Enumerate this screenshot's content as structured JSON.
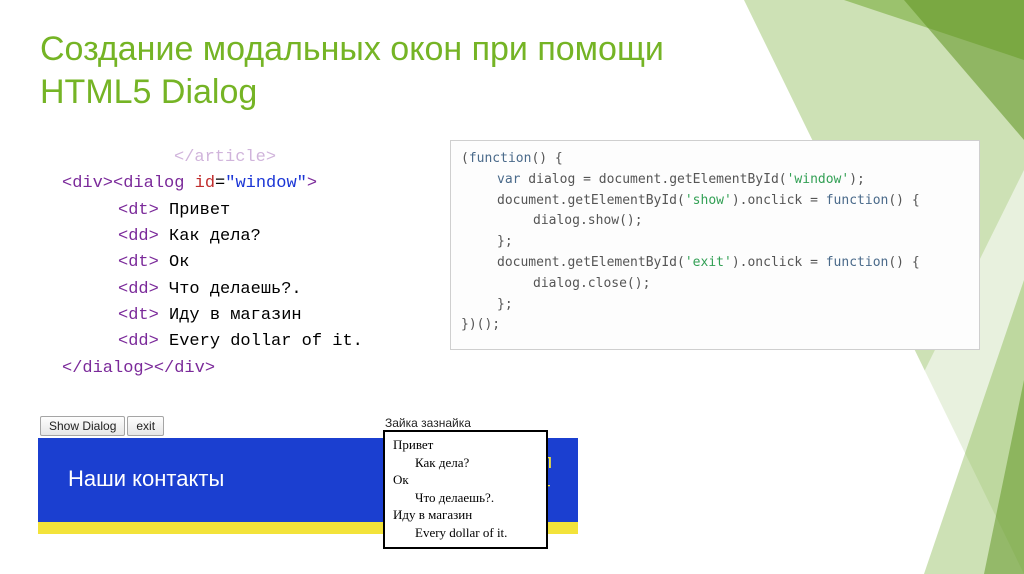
{
  "title_line1": "Создание модальных окон при помощи",
  "title_line2": "HTML5 Dialog",
  "html_code": {
    "l0": "</article>",
    "l1_open_div": "<div>",
    "l1_open_dialog": "<dialog",
    "l1_attr_id": " id",
    "l1_eq": "=",
    "l1_val": "\"window\"",
    "l1_close": ">",
    "l2_tag": "<dt>",
    "l2_txt": " Привет",
    "l3_tag": "<dd>",
    "l3_txt": " Как дела?",
    "l4_tag": "<dt>",
    "l4_txt": " Ок",
    "l5_tag": "<dd>",
    "l5_txt": " Что делаешь?.",
    "l6_tag": "<dt>",
    "l6_txt": " Иду в магазин",
    "l7_tag": "<dd>",
    "l7_txt": " Every dollar of it.",
    "l8_close_dialog": "</dialog>",
    "l8_close_div": "</div>"
  },
  "js_code": {
    "a": "(",
    "a_fn": "function",
    "a2": "() {",
    "b_var": "var",
    "b_rest": " dialog = document.getElementById(",
    "b_str": "'window'",
    "b_end": ");",
    "c_pre": "document.getElementById(",
    "c_str": "'show'",
    "c_mid": ").onclick = ",
    "c_fn": "function",
    "c_end": "() {",
    "d": "dialog.show();",
    "e": "};",
    "f_pre": "document.getElementById(",
    "f_str": "'exit'",
    "f_mid": ").onclick = ",
    "f_fn": "function",
    "f_end": "() {",
    "g": "dialog.close();",
    "h": "};",
    "i": "})();"
  },
  "buttons": {
    "show": "Show Dialog",
    "exit": "exit"
  },
  "caption": "Зайка зазнайка",
  "banner_text": "Наши контакты",
  "banner_extra_1": "ел",
  "banner_extra_2": "ит",
  "dialog_preview": {
    "dt1": "Привет",
    "dd1": "Как дела?",
    "dt2": "Ок",
    "dd2": "Что делаешь?.",
    "dt3": "Иду в магазин",
    "dd3": "Every dollar of it."
  }
}
